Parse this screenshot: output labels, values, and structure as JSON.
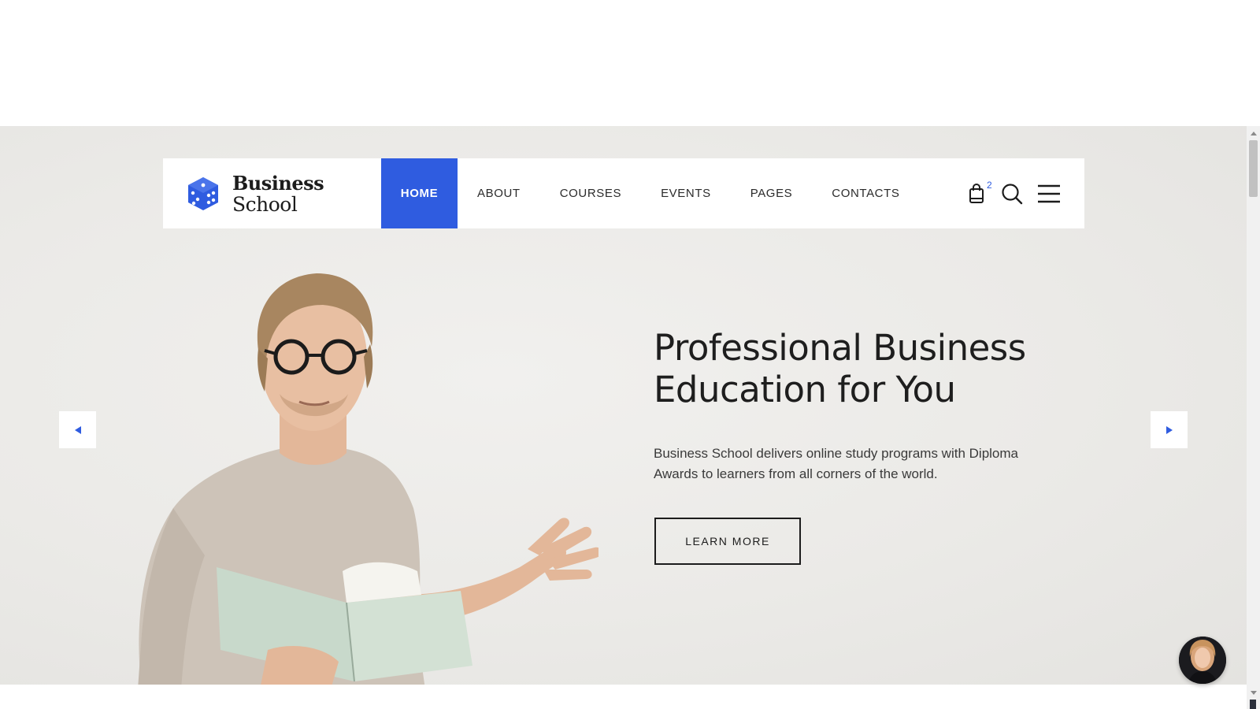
{
  "logo": {
    "line1": "Business",
    "line2": "School",
    "icon": "dice-cube-icon"
  },
  "nav": {
    "items": [
      {
        "label": "HOME",
        "active": true
      },
      {
        "label": "ABOUT",
        "active": false
      },
      {
        "label": "COURSES",
        "active": false
      },
      {
        "label": "EVENTS",
        "active": false
      },
      {
        "label": "PAGES",
        "active": false
      },
      {
        "label": "CONTACTS",
        "active": false
      }
    ],
    "cart_count": "2",
    "tools": [
      "shopping-bag-icon",
      "search-icon",
      "hamburger-menu-icon"
    ]
  },
  "hero": {
    "title": "Professional Business Education for You",
    "text": "Business School delivers online study programs with Diploma Awards to learners from all corners of the world.",
    "button": "LEARN MORE"
  },
  "colors": {
    "accent": "#2f5ce0",
    "hero_bg": "#ebeae7",
    "text": "#1c1c1c"
  }
}
